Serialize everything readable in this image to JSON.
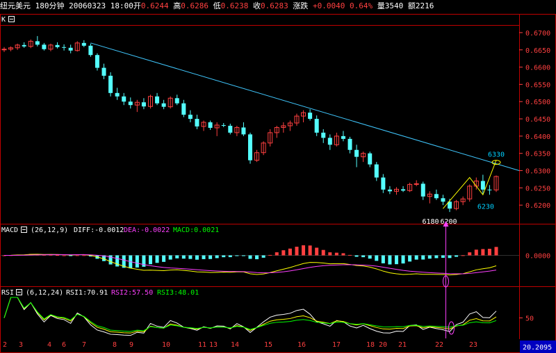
{
  "header": {
    "symbol": "纽元美元",
    "period": "180分钟",
    "datetime": "20060323 18:00",
    "open_label": "开",
    "open": "0.6244",
    "high_label": "高",
    "high": "0.6286",
    "low_label": "低",
    "low": "0.6238",
    "close_label": "收",
    "close": "0.6283",
    "change_label": "涨跌",
    "change": "+0.0040",
    "change_pct": "0.64%",
    "volume_label": "量",
    "volume": "3540",
    "amount_label": "额",
    "amount": "2216"
  },
  "colors": {
    "up": "#ff4040",
    "down": "#54ffff",
    "frame": "#c00000",
    "trend": "#40c8ff",
    "magenta": "#ff40ff",
    "yellow": "#ffff00",
    "green": "#00ff00",
    "white": "#ffffff"
  },
  "chart_data": [
    {
      "type": "candlestick",
      "panel_label": "K",
      "ylim": [
        0.615,
        0.672
      ],
      "yticks": [
        "0.6700",
        "0.6650",
        "0.6600",
        "0.6550",
        "0.6500",
        "0.6450",
        "0.6400",
        "0.6350",
        "0.6300",
        "0.6250",
        "0.6200"
      ],
      "x_labels": [
        "2",
        "3",
        "4",
        "6",
        "7",
        "8",
        "9",
        "10",
        "11",
        "13",
        "14",
        "15",
        "16",
        "17",
        "18",
        "20",
        "21",
        "22",
        "23"
      ],
      "candles": [
        [
          0.665,
          0.6658,
          0.6644,
          0.6652
        ],
        [
          0.6652,
          0.666,
          0.6646,
          0.6656
        ],
        [
          0.6656,
          0.6668,
          0.665,
          0.6664
        ],
        [
          0.6664,
          0.6672,
          0.6656,
          0.666
        ],
        [
          0.666,
          0.668,
          0.6655,
          0.6675
        ],
        [
          0.6675,
          0.669,
          0.666,
          0.6665
        ],
        [
          0.6665,
          0.667,
          0.6648,
          0.6652
        ],
        [
          0.6652,
          0.6668,
          0.6646,
          0.6664
        ],
        [
          0.6664,
          0.6672,
          0.6654,
          0.6658
        ],
        [
          0.6658,
          0.6666,
          0.6648,
          0.6656
        ],
        [
          0.6656,
          0.6665,
          0.664,
          0.6648
        ],
        [
          0.6648,
          0.6675,
          0.6645,
          0.667
        ],
        [
          0.667,
          0.6678,
          0.6658,
          0.6662
        ],
        [
          0.6662,
          0.6668,
          0.663,
          0.6635
        ],
        [
          0.6635,
          0.664,
          0.659,
          0.6598
        ],
        [
          0.6598,
          0.661,
          0.6565,
          0.6575
        ],
        [
          0.6575,
          0.6585,
          0.6515,
          0.6525
        ],
        [
          0.6525,
          0.654,
          0.6505,
          0.6515
        ],
        [
          0.6515,
          0.6525,
          0.649,
          0.65
        ],
        [
          0.65,
          0.6512,
          0.648,
          0.649
        ],
        [
          0.649,
          0.6505,
          0.647,
          0.6498
        ],
        [
          0.6498,
          0.651,
          0.6478,
          0.6486
        ],
        [
          0.6486,
          0.652,
          0.648,
          0.6515
        ],
        [
          0.6515,
          0.6525,
          0.649,
          0.6495
        ],
        [
          0.6495,
          0.6505,
          0.6478,
          0.6485
        ],
        [
          0.6485,
          0.6515,
          0.648,
          0.651
        ],
        [
          0.651,
          0.652,
          0.649,
          0.6495
        ],
        [
          0.6495,
          0.6505,
          0.6455,
          0.6462
        ],
        [
          0.6462,
          0.6475,
          0.644,
          0.645
        ],
        [
          0.645,
          0.6462,
          0.642,
          0.6428
        ],
        [
          0.6428,
          0.6445,
          0.6415,
          0.644
        ],
        [
          0.644,
          0.6445,
          0.6418,
          0.6424
        ],
        [
          0.6424,
          0.644,
          0.64,
          0.6432
        ],
        [
          0.6432,
          0.6438,
          0.6426,
          0.643
        ],
        [
          0.643,
          0.6436,
          0.6405,
          0.641
        ],
        [
          0.641,
          0.643,
          0.64,
          0.6425
        ],
        [
          0.6425,
          0.644,
          0.64,
          0.6405
        ],
        [
          0.6405,
          0.641,
          0.632,
          0.633
        ],
        [
          0.633,
          0.636,
          0.6325,
          0.6352
        ],
        [
          0.6352,
          0.6385,
          0.6345,
          0.638
        ],
        [
          0.638,
          0.642,
          0.637,
          0.641
        ],
        [
          0.641,
          0.643,
          0.6395,
          0.6425
        ],
        [
          0.6425,
          0.644,
          0.641,
          0.643
        ],
        [
          0.643,
          0.6445,
          0.6415,
          0.6438
        ],
        [
          0.6438,
          0.6465,
          0.643,
          0.6458
        ],
        [
          0.6458,
          0.6475,
          0.644,
          0.6468
        ],
        [
          0.6468,
          0.6478,
          0.6445,
          0.645
        ],
        [
          0.645,
          0.646,
          0.64,
          0.641
        ],
        [
          0.641,
          0.642,
          0.638,
          0.6395
        ],
        [
          0.6395,
          0.6405,
          0.636,
          0.6375
        ],
        [
          0.6375,
          0.641,
          0.637,
          0.64
        ],
        [
          0.64,
          0.6415,
          0.6385,
          0.6392
        ],
        [
          0.6392,
          0.6398,
          0.635,
          0.636
        ],
        [
          0.636,
          0.6375,
          0.631,
          0.634
        ],
        [
          0.634,
          0.6355,
          0.6325,
          0.635
        ],
        [
          0.635,
          0.6355,
          0.631,
          0.6318
        ],
        [
          0.6318,
          0.6325,
          0.627,
          0.628
        ],
        [
          0.628,
          0.629,
          0.6235,
          0.6245
        ],
        [
          0.6245,
          0.6255,
          0.6232,
          0.624
        ],
        [
          0.624,
          0.6252,
          0.623,
          0.6246
        ],
        [
          0.6246,
          0.6255,
          0.6238,
          0.6242
        ],
        [
          0.6242,
          0.6265,
          0.6238,
          0.626
        ],
        [
          0.626,
          0.6272,
          0.6255,
          0.6262
        ],
        [
          0.6262,
          0.6268,
          0.6215,
          0.6225
        ],
        [
          0.6225,
          0.624,
          0.6205,
          0.6232
        ],
        [
          0.6232,
          0.6245,
          0.6215,
          0.622
        ],
        [
          0.622,
          0.623,
          0.62,
          0.621
        ],
        [
          0.621,
          0.6218,
          0.618,
          0.619
        ],
        [
          0.619,
          0.6215,
          0.6185,
          0.621
        ],
        [
          0.621,
          0.6225,
          0.62,
          0.6218
        ],
        [
          0.6218,
          0.626,
          0.621,
          0.6255
        ],
        [
          0.6255,
          0.628,
          0.6245,
          0.627
        ],
        [
          0.627,
          0.6288,
          0.623,
          0.6245
        ],
        [
          0.6245,
          0.6258,
          0.623,
          0.6244
        ],
        [
          0.6244,
          0.6286,
          0.6238,
          0.6283
        ]
      ],
      "trendline": {
        "from": 0.667,
        "to": 0.63
      },
      "annotations": [
        "6330",
        "6230",
        "6180",
        "6200"
      ]
    },
    {
      "type": "bar",
      "panel_label": "MACD",
      "params": "(26,12,9)",
      "legend": [
        {
          "name": "DIFF",
          "value": "-0.0012"
        },
        {
          "name": "DEA",
          "value": "-0.0022"
        },
        {
          "name": "MACD",
          "value": "0.0021"
        }
      ],
      "ylim": [
        -0.0085,
        0.0055
      ],
      "yticks": [
        "0.0000"
      ]
    },
    {
      "type": "line",
      "panel_label": "RSI",
      "params": "(6,12,24)",
      "legend": [
        {
          "name": "RSI1",
          "value": "70.91"
        },
        {
          "name": "RSI2",
          "value": "57.50"
        },
        {
          "name": "RSI3",
          "value": "48.01"
        }
      ],
      "ylim": [
        0,
        100
      ],
      "yticks": [
        "50"
      ],
      "corner_value": "20.2095"
    }
  ]
}
